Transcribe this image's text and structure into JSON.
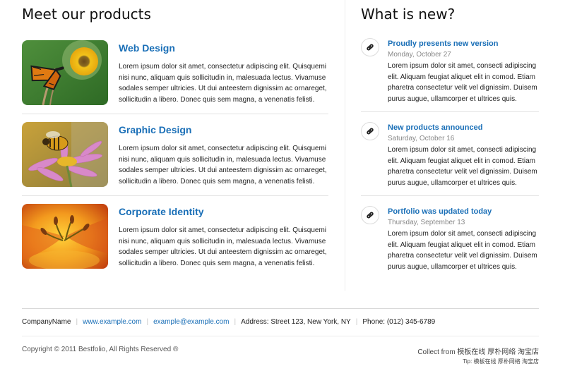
{
  "products": {
    "heading": "Meet our products",
    "items": [
      {
        "title": "Web Design",
        "text": "Lorem ipsum dolor sit amet, consectetur adipiscing elit. Quisquemi nisi nunc, aliquam quis sollicitudin in, malesuada lectus. Vivamuse sodales semper ultricies. Ut dui anteestem dignissim ac ornareget, sollicitudin a libero. Donec quis sem magna, a venenatis felisti.",
        "image": "butterfly-on-sunflower"
      },
      {
        "title": "Graphic Design",
        "text": "Lorem ipsum dolor sit amet, consectetur adipiscing elit. Quisquemi nisi nunc, aliquam quis sollicitudin in, malesuada lectus. Vivamuse sodales semper ultricies. Ut dui anteestem dignissim ac ornareget, sollicitudin a libero. Donec quis sem magna, a venenatis felisti.",
        "image": "bee-on-pink-flower"
      },
      {
        "title": "Corporate Identity",
        "text": "Lorem ipsum dolor sit amet, consectetur adipiscing elit. Quisquemi nisi nunc, aliquam quis sollicitudin in, malesuada lectus. Vivamuse sodales semper ultricies. Ut dui anteestem dignissim ac ornareget, sollicitudin a libero. Donec quis sem magna, a venenatis felisti.",
        "image": "orange-lily-closeup"
      }
    ]
  },
  "news": {
    "heading": "What is new?",
    "icon": "link-icon",
    "items": [
      {
        "title": "Proudly presents new version",
        "date": "Monday, October 27",
        "text": "Lorem ipsum dolor sit amet, consecti adipiscing elit. Aliquam feugiat aliquet elit in comod. Etiam pharetra consectetur velit vel dignissim. Duisem purus augue, ullamcorper et ultrices quis."
      },
      {
        "title": "New products announced",
        "date": "Saturday, October 16",
        "text": "Lorem ipsum dolor sit amet, consecti adipiscing elit. Aliquam feugiat aliquet elit in comod. Etiam pharetra consectetur velit vel dignissim. Duisem purus augue, ullamcorper et ultrices quis."
      },
      {
        "title": "Portfolio was updated today",
        "date": "Thursday, September 13",
        "text": "Lorem ipsum dolor sit amet, consecti adipiscing elit. Aliquam feugiat aliquet elit in comod. Etiam pharetra consectetur velit vel dignissim. Duisem purus augue, ullamcorper et ultrices quis."
      }
    ]
  },
  "footer": {
    "company": "CompanyName",
    "website": "www.example.com",
    "email": "example@example.com",
    "address": "Address: Street 123, New York, NY",
    "phone": "Phone: (012) 345-6789",
    "copyright": "Copyright © 2011 Bestfolio, All Rights Reserved ®",
    "collect": "Collect from 模板在线 厚朴网络 淘宝店",
    "tip": "Tip: 模板在线 厚朴网络 淘宝店"
  },
  "colors": {
    "link": "#1a6fb7",
    "text": "#222222",
    "muted": "#888888"
  }
}
